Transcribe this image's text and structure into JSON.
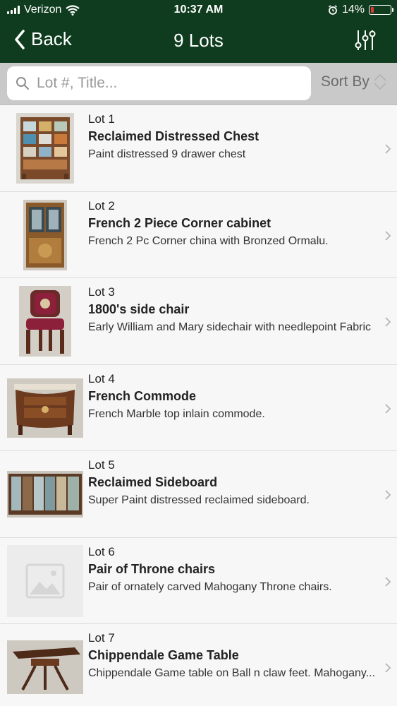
{
  "status_bar": {
    "carrier": "Verizon",
    "time": "10:37 AM",
    "battery_percent": "14%",
    "battery_color": "#e53935",
    "icons": [
      "signal-bars-icon",
      "wifi-icon",
      "alarm-icon",
      "battery-icon"
    ]
  },
  "nav": {
    "back_label": "Back",
    "title": "9 Lots",
    "filter_icon": "sliders-icon",
    "bar_color": "#0f3b1e"
  },
  "search": {
    "placeholder": "Lot #, Title...",
    "value": "",
    "sort_label": "Sort By"
  },
  "lots": [
    {
      "lot": "Lot 1",
      "title": "Reclaimed Distressed Chest",
      "description": "Paint distressed 9 drawer chest",
      "image": "chest-photo"
    },
    {
      "lot": "Lot 2",
      "title": "French 2 Piece Corner cabinet",
      "description": "French 2 Pc Corner china with Bronzed Ormalu.",
      "image": "corner-cabinet-photo"
    },
    {
      "lot": "Lot 3",
      "title": "1800's side chair",
      "description": "Early William and Mary sidechair with needlepoint Fabric",
      "image": "side-chair-photo"
    },
    {
      "lot": "Lot 4",
      "title": "French Commode",
      "description": "French Marble top inlain commode.",
      "image": "commode-photo"
    },
    {
      "lot": "Lot 5",
      "title": "Reclaimed Sideboard",
      "description": "Super Paint distressed reclaimed sideboard.",
      "image": "sideboard-photo"
    },
    {
      "lot": "Lot 6",
      "title": "Pair of Throne chairs",
      "description": "Pair of ornately carved Mahogany Throne chairs.",
      "image": "placeholder-image-icon"
    },
    {
      "lot": "Lot 7",
      "title": "Chippendale Game Table",
      "description": "Chippendale Game table on Ball n claw feet. Mahogany...",
      "image": "game-table-photo"
    }
  ]
}
